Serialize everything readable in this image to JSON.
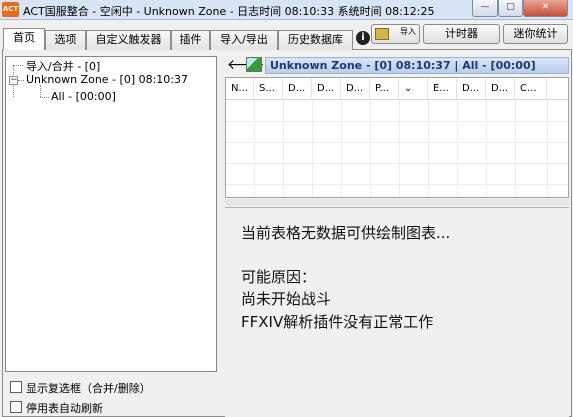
{
  "window": {
    "app_icon": "ACT",
    "title": "ACT国服整合 - 空闲中 - Unknown Zone - 日志时间 08:10:33 系统时间 08:12:25",
    "minimize": "—",
    "maximize": "□",
    "close": "✕"
  },
  "tabs": [
    {
      "label": "首页",
      "active": true
    },
    {
      "label": "选项"
    },
    {
      "label": "自定义触发器"
    },
    {
      "label": "插件"
    },
    {
      "label": "导入/导出"
    },
    {
      "label": "历史数据库"
    }
  ],
  "info_icon": "i",
  "toolbar": {
    "import_label": "导入",
    "timer_label": "计时器",
    "mini_label": "迷你统计"
  },
  "tree": {
    "items": [
      {
        "label": "导入/合并 - [0]"
      },
      {
        "label": "Unknown Zone - [0] 08:10:37",
        "expander": "−"
      },
      {
        "label": "All - [00:00]"
      }
    ]
  },
  "options": {
    "show_checkboxes": "显示复选框（合并/删除）",
    "auto_refresh": "停用表自动刷新"
  },
  "encounter": {
    "back_arrow": "🡐",
    "header": "Unknown Zone - [0] 08:10:37 | All - [00:00]"
  },
  "table": {
    "columns": [
      "N...",
      "S...",
      "D...",
      "D...",
      "D...",
      "P...",
      "⌄",
      "E...",
      "D...",
      "D...",
      "C..."
    ]
  },
  "chart_panel": {
    "line1": "当前表格无数据可供绘制图表...",
    "line2": "可能原因：",
    "line3": "尚未开始战斗",
    "line4": "FFXIV解析插件没有正常工作"
  }
}
